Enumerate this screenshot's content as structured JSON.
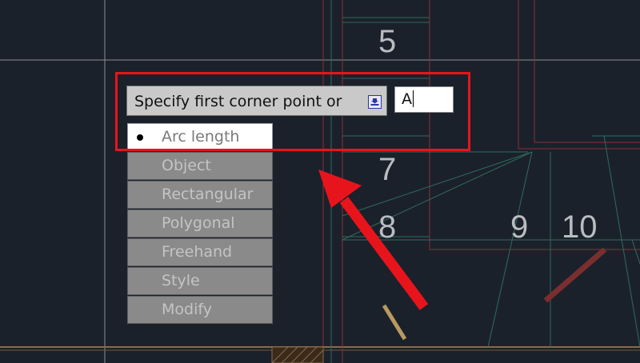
{
  "drawing": {
    "room_numbers": [
      "5",
      "7",
      "8",
      "9",
      "10"
    ]
  },
  "tooltip": {
    "prompt": "Specify first corner point or",
    "options_button_icon": "arrow-down-icon"
  },
  "command_input": {
    "value": "A"
  },
  "options_menu": {
    "items": [
      {
        "label": "Arc length",
        "selected": true
      },
      {
        "label": "Object"
      },
      {
        "label": "Rectangular"
      },
      {
        "label": "Polygonal"
      },
      {
        "label": "Freehand"
      },
      {
        "label": "Style"
      },
      {
        "label": "Modify"
      }
    ]
  },
  "annotation": {
    "highlight_color": "#e8141c",
    "arrow_color": "#e8141c"
  },
  "colors": {
    "canvas_background": "#1b212b",
    "grid_line": "#8b8f94",
    "wall_line": "#8a2e34",
    "stair_line": "#2f6b5d"
  }
}
